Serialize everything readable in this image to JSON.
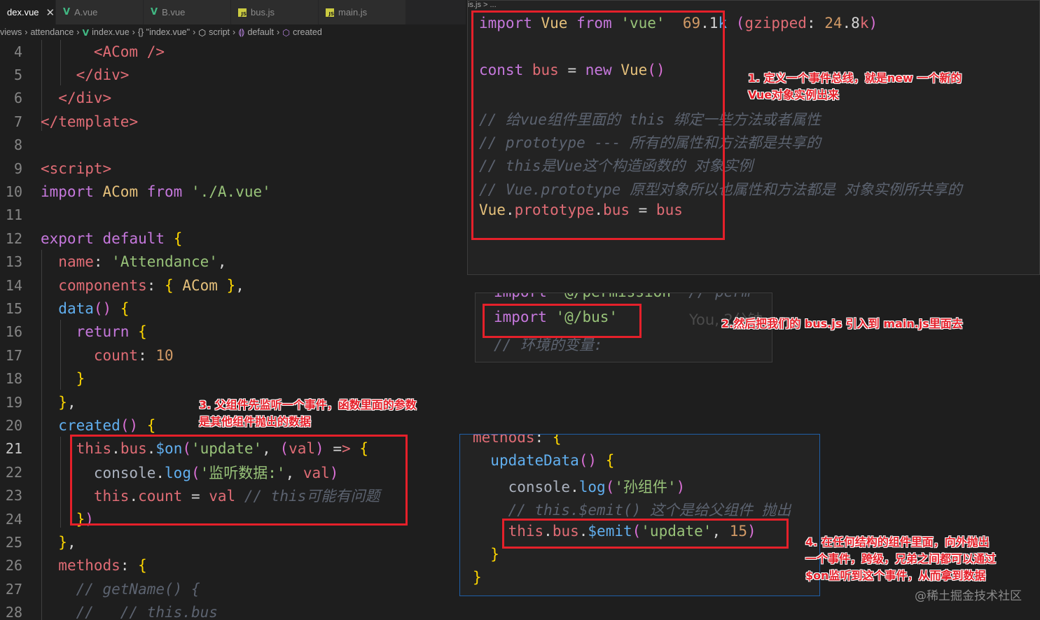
{
  "tabs": [
    {
      "label": "dex.vue",
      "icon": "none",
      "active": true,
      "closable": true
    },
    {
      "label": "A.vue",
      "icon": "vue-icon"
    },
    {
      "label": "B.vue",
      "icon": "vue-icon"
    },
    {
      "label": "bus.js",
      "icon": "js-icon"
    },
    {
      "label": "main.js",
      "icon": "js-icon"
    }
  ],
  "breadcrumb": [
    "views",
    "attendance",
    "index.vue",
    "{} \"index.vue\"",
    "script",
    "default",
    "created"
  ],
  "editor": {
    "lines": [
      {
        "n": "4",
        "text": "      <ACom />"
      },
      {
        "n": "5",
        "text": "    </div>"
      },
      {
        "n": "6",
        "text": "  </div>"
      },
      {
        "n": "7",
        "text": "</template>"
      },
      {
        "n": "8",
        "text": ""
      },
      {
        "n": "9",
        "text": "<script>"
      },
      {
        "n": "10",
        "text": "import ACom from './A.vue'"
      },
      {
        "n": "11",
        "text": ""
      },
      {
        "n": "12",
        "text": "export default {"
      },
      {
        "n": "13",
        "text": "  name: 'Attendance',"
      },
      {
        "n": "14",
        "text": "  components: { ACom },"
      },
      {
        "n": "15",
        "text": "  data() {"
      },
      {
        "n": "16",
        "text": "    return {"
      },
      {
        "n": "17",
        "text": "      count: 10"
      },
      {
        "n": "18",
        "text": "    }"
      },
      {
        "n": "19",
        "text": "  },"
      },
      {
        "n": "20",
        "text": "  created() {"
      },
      {
        "n": "21",
        "text": "    this.bus.$on('update', (val) => {"
      },
      {
        "n": "22",
        "text": "      console.log('监听数据:', val)"
      },
      {
        "n": "23",
        "text": "      this.count = val // this可能有问题"
      },
      {
        "n": "24",
        "text": "    })"
      },
      {
        "n": "25",
        "text": "  },"
      },
      {
        "n": "26",
        "text": "  methods: {"
      },
      {
        "n": "27",
        "text": "    // getName() {"
      },
      {
        "n": "28",
        "text": "    //   // this.bus"
      }
    ],
    "current_line": "21"
  },
  "bus_panel": {
    "header": "is.js > ...",
    "lines": [
      "import Vue from 'vue'  69.1k (gzipped: 24.8k)",
      "",
      "const bus = new Vue()",
      "",
      "// 给vue组件里面的 this 绑定一些方法或者属性",
      "// prototype --- 所有的属性和方法都是共享的",
      "// this是Vue这个构造函数的 对象实例",
      "// Vue.prototype 原型对象所以也属性和方法都是 对象实例所共享的",
      "Vue.prototype.bus = bus"
    ]
  },
  "main_panel": {
    "lines": [
      "import '@/permission' // perm",
      "import '@/bus'",
      "// 环境的变量:"
    ],
    "ghost": "You, 2分钟"
  },
  "emit_panel": {
    "lines": [
      "methods: {",
      "  updateData() {",
      "    console.log('孙组件')",
      "    // this.$emit() 这个是给父组件 抛出",
      "    this.bus.$emit('update', 15)",
      "  }",
      "}"
    ]
  },
  "notes": {
    "n1": "1. 定义一个事件总线，就是new 一个新的\nVue对象实例出来",
    "n2": "2.然后把我们的 bus.js 引入到 main.js里面去",
    "n3": "3. 父组件先监听一个事件，函数里面的参数\n是其他组件抛出的数据",
    "n4": "4. 在任何结构的组件里面，向外抛出\n一个事件，跨级，兄弟之间都可以通过\n$on监听到这个事件，从而拿到数据"
  },
  "watermark": "@稀土掘金技术社区",
  "colors": {
    "annotation_red": "#e5202a",
    "editor_bg": "#1e1e1e",
    "vue_green": "#41b883"
  }
}
